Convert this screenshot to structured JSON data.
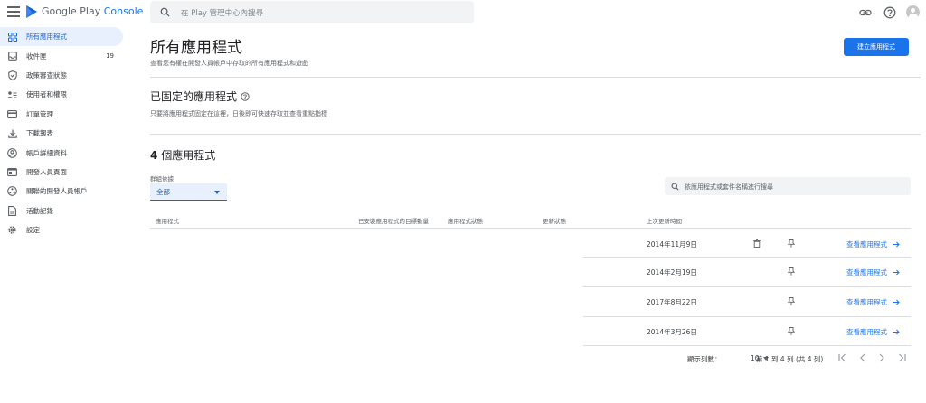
{
  "header": {
    "brand_google_play": "Google Play",
    "brand_console": "Console",
    "search_placeholder": "在 Play 管理中心內搜尋",
    "icons": [
      "menu-icon",
      "search-icon",
      "link-icon",
      "help-icon",
      "account-avatar"
    ]
  },
  "sidebar": {
    "items": [
      {
        "label": "所有應用程式",
        "icon": "apps-grid-icon",
        "active": true
      },
      {
        "label": "收件匣",
        "icon": "inbox-icon",
        "count": "19"
      },
      {
        "label": "政策審查狀態",
        "icon": "shield-check-icon"
      },
      {
        "label": "使用者和權限",
        "icon": "users-icon"
      },
      {
        "label": "訂單管理",
        "icon": "credit-card-icon"
      },
      {
        "label": "下載報表",
        "icon": "download-icon"
      },
      {
        "label": "帳戶詳細資料",
        "icon": "account-circle-icon"
      },
      {
        "label": "開發人員頁面",
        "icon": "web-page-icon"
      },
      {
        "label": "關聯的開發人員帳戶",
        "icon": "linked-accounts-icon"
      },
      {
        "label": "活動記錄",
        "icon": "document-icon"
      },
      {
        "label": "設定",
        "icon": "settings-gear-icon"
      }
    ]
  },
  "main": {
    "title": "所有應用程式",
    "subtitle": "查看您有權在開發人員帳戶中存取的所有應用程式和遊戲",
    "create_button": "建立應用程式",
    "pinned_title": "已固定的應用程式",
    "pinned_subtitle": "只要將應用程式固定在這裡，日後即可快速存取並查看重點指標",
    "apps_count_number": "4",
    "apps_count_label": "個應用程式",
    "filter_label": "群組依據",
    "filter_value": "全部",
    "app_search_placeholder": "依應用程式或套件名稱進行搜尋",
    "table": {
      "headers": [
        "應用程式",
        "已安裝應用程式的目標數量",
        "應用程式狀態",
        "更新狀態",
        "上次更新時間"
      ],
      "rows": [
        {
          "date": "2014年11月9日",
          "link": "查看應用程式",
          "has_delete": true
        },
        {
          "date": "2014年2月19日",
          "link": "查看應用程式",
          "has_delete": false
        },
        {
          "date": "2017年8月22日",
          "link": "查看應用程式",
          "has_delete": false
        },
        {
          "date": "2014年3月26日",
          "link": "查看應用程式",
          "has_delete": false
        }
      ]
    },
    "pagination": {
      "rows_label": "顯示列數：",
      "rows_value": "10",
      "range_text": "第 1 到 4 列 (共 4 列)"
    }
  },
  "colors": {
    "accent": "#1a73e8",
    "active_bg": "#e8f0fe",
    "divider": "#dadce0"
  }
}
